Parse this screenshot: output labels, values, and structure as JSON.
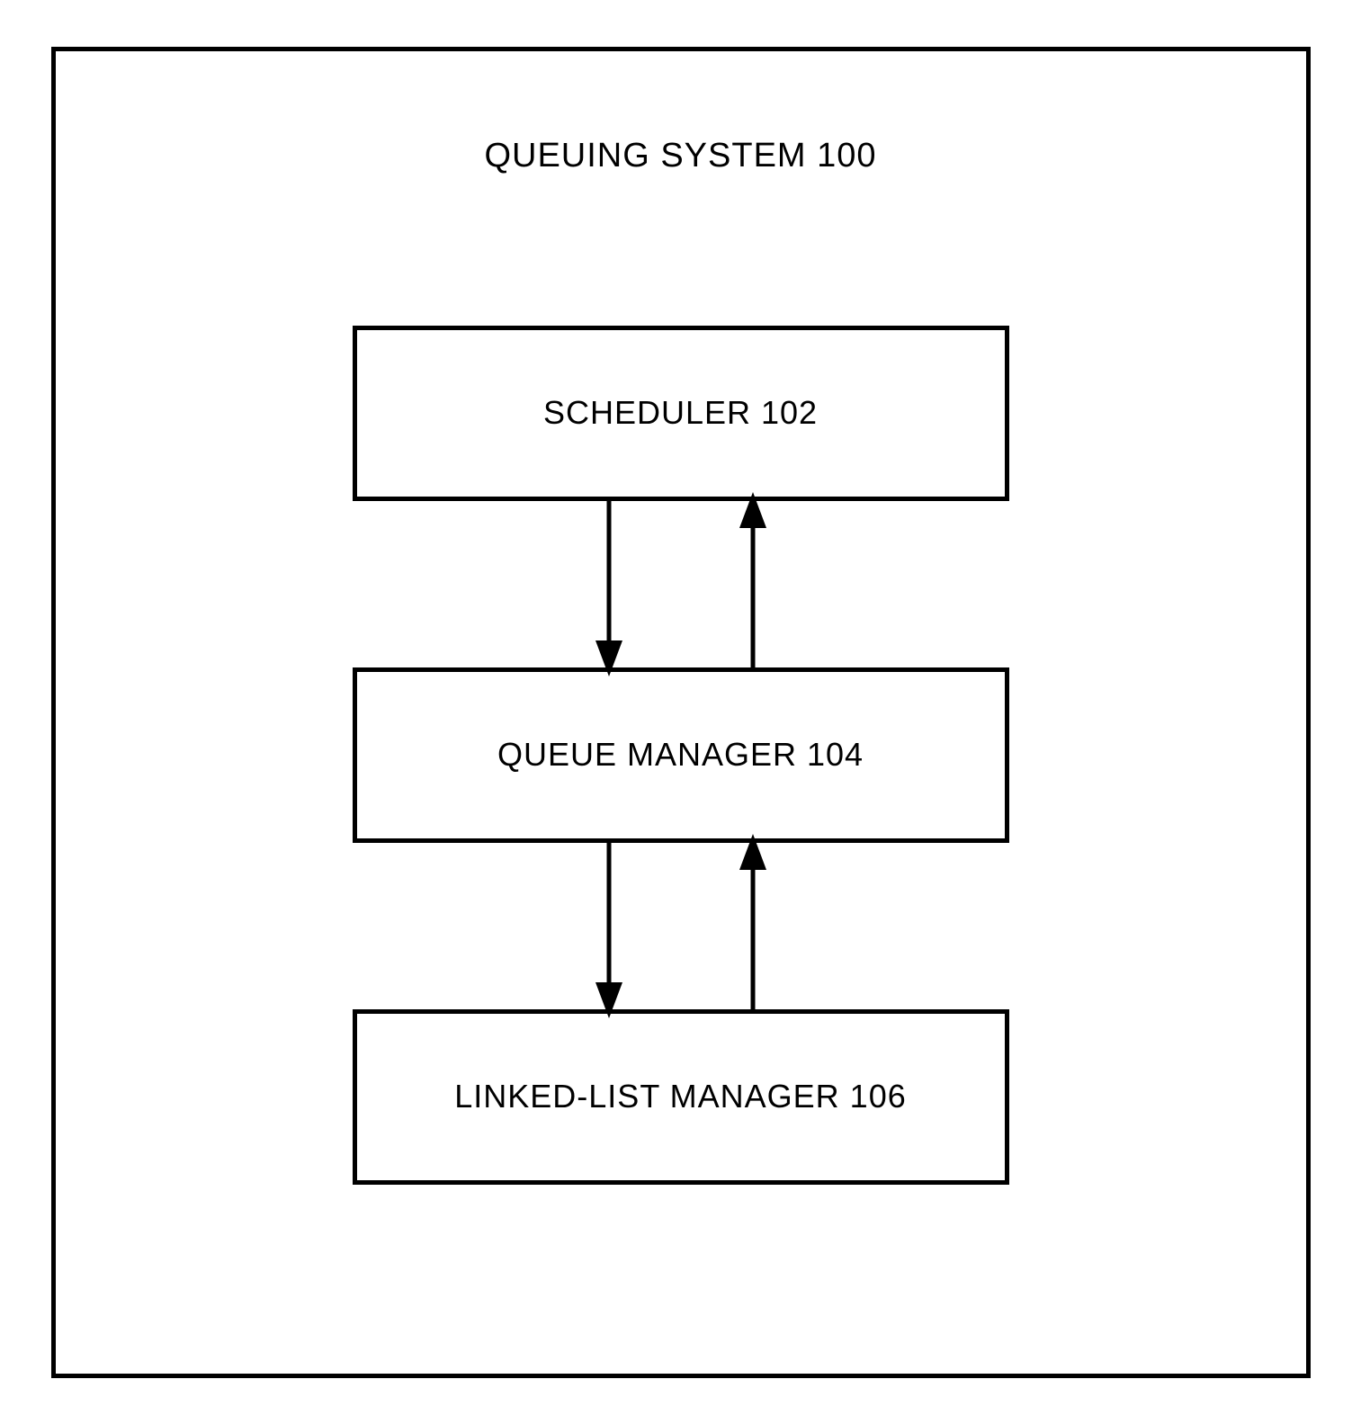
{
  "diagram": {
    "title": "QUEUING SYSTEM 100",
    "boxes": {
      "scheduler": "SCHEDULER 102",
      "queue_manager": "QUEUE MANAGER 104",
      "linked_list_manager": "LINKED-LIST MANAGER 106"
    },
    "connections": [
      {
        "from": "scheduler",
        "to": "queue_manager",
        "bidirectional": true
      },
      {
        "from": "queue_manager",
        "to": "linked_list_manager",
        "bidirectional": true
      }
    ]
  }
}
